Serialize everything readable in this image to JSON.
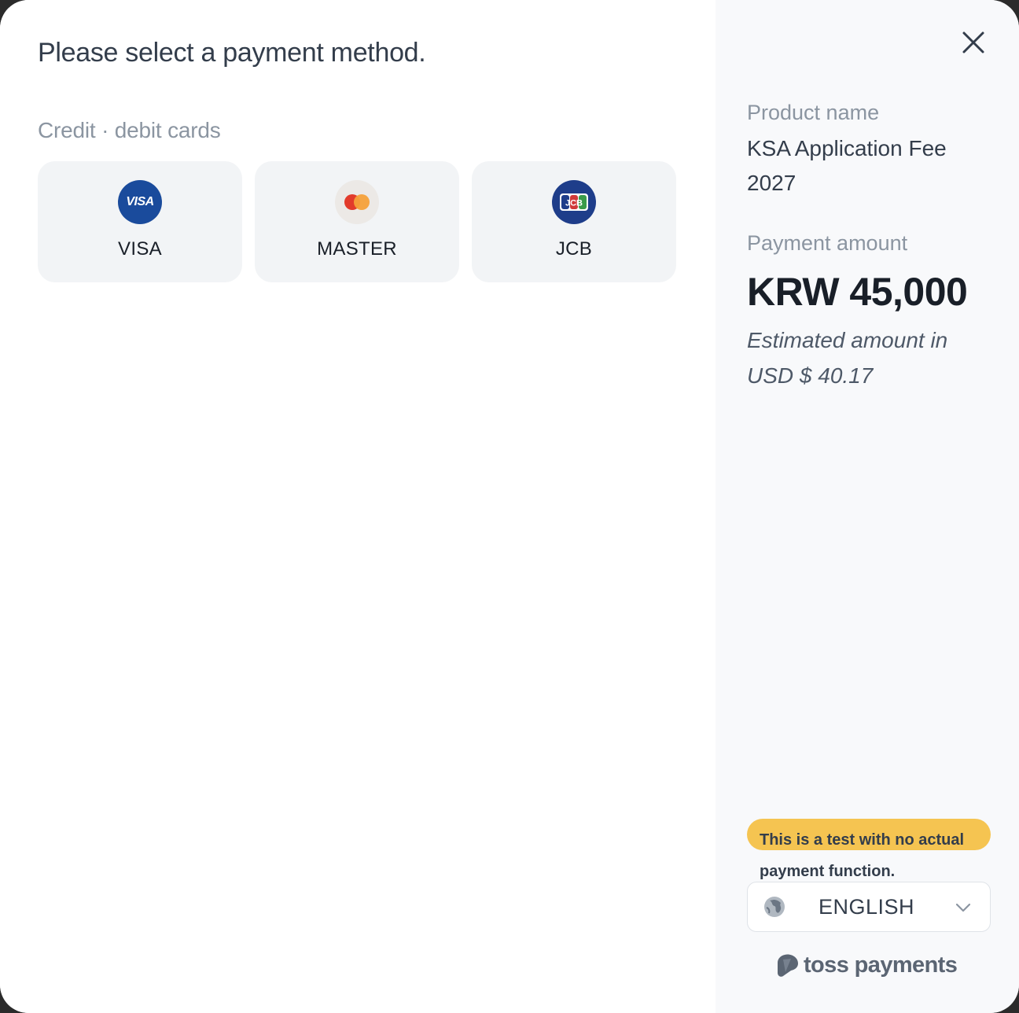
{
  "main": {
    "title": "Please select a payment method.",
    "section_label": "Credit · debit cards",
    "cards": [
      {
        "name": "VISA",
        "logo_text": "VISA",
        "icon": "visa-logo-icon"
      },
      {
        "name": "MASTER",
        "icon": "mastercard-logo-icon"
      },
      {
        "name": "JCB",
        "logo_text": "JCB",
        "icon": "jcb-logo-icon"
      }
    ]
  },
  "side": {
    "product_label": "Product name",
    "product_value": "KSA Application Fee 2027",
    "amount_label": "Payment amount",
    "amount_value": "KRW 45,000",
    "estimate": "Estimated amount in USD $ 40.17",
    "test_notice": "This is a test with no actual payment function.",
    "language": "ENGLISH",
    "brand": "toss payments"
  },
  "colors": {
    "notice_bg": "#f5c451",
    "visa_blue": "#1a4b9c",
    "jcb_blue": "#1e3d8a",
    "master_red": "#e23b2b",
    "master_orange": "#f6a13a"
  }
}
